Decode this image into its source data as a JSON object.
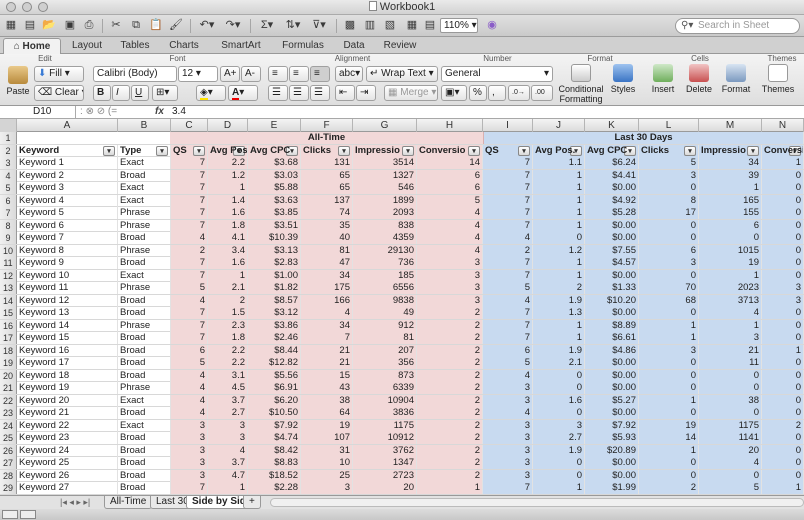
{
  "window": {
    "title": "Workbook1"
  },
  "toolbar": {
    "zoom": "110%",
    "search_placeholder": "Search in Sheet"
  },
  "ribbon": {
    "tabs": [
      "Home",
      "Layout",
      "Tables",
      "Charts",
      "SmartArt",
      "Formulas",
      "Data",
      "Review"
    ],
    "groups": {
      "edit": "Edit",
      "font": "Font",
      "alignment": "Alignment",
      "number": "Number",
      "format": "Format",
      "cells": "Cells",
      "themes": "Themes"
    },
    "paste": "Paste",
    "fill": "Fill",
    "clear": "Clear",
    "font_name": "Calibri (Body)",
    "font_size": "12",
    "wrap_text": "Wrap Text",
    "merge": "Merge",
    "number_format": "General",
    "conditional": "Conditional",
    "formatting": "Formatting",
    "styles": "Styles",
    "insert": "Insert",
    "delete": "Delete",
    "format": "Format",
    "themes": "Themes",
    "abc": "abc"
  },
  "formula_bar": {
    "cell": "D10",
    "value": "3.4",
    "fx": "fx"
  },
  "columns": [
    "A",
    "B",
    "C",
    "D",
    "E",
    "F",
    "G",
    "H",
    "I",
    "J",
    "K",
    "L",
    "M",
    "N"
  ],
  "row1": {
    "alltime": "All-Time",
    "last30": "Last 30 Days"
  },
  "headers": [
    "Keyword",
    "Type",
    "QS",
    "Avg Pos.",
    "Avg CPC",
    "Clicks",
    "Impressio",
    "Conversio",
    "QS",
    "Avg Pos.",
    "Avg CPC",
    "Clicks",
    "Impressio",
    "Conversio"
  ],
  "rows": [
    [
      "3",
      "Keyword 1",
      "Exact",
      "7",
      "2.2",
      "$3.68",
      "131",
      "3514",
      "14",
      "7",
      "1.1",
      "$6.24",
      "5",
      "34",
      "1"
    ],
    [
      "4",
      "Keyword 2",
      "Broad",
      "7",
      "1.2",
      "$3.03",
      "65",
      "1327",
      "6",
      "7",
      "1",
      "$4.41",
      "3",
      "39",
      "0"
    ],
    [
      "5",
      "Keyword 3",
      "Exact",
      "7",
      "1",
      "$5.88",
      "65",
      "546",
      "6",
      "7",
      "1",
      "$0.00",
      "0",
      "1",
      "0"
    ],
    [
      "6",
      "Keyword 4",
      "Exact",
      "7",
      "1.4",
      "$3.63",
      "137",
      "1899",
      "5",
      "7",
      "1",
      "$4.92",
      "8",
      "165",
      "0"
    ],
    [
      "7",
      "Keyword 5",
      "Phrase",
      "7",
      "1.6",
      "$3.85",
      "74",
      "2093",
      "4",
      "7",
      "1",
      "$5.28",
      "17",
      "155",
      "0"
    ],
    [
      "8",
      "Keyword 6",
      "Phrase",
      "7",
      "1.8",
      "$3.51",
      "35",
      "838",
      "4",
      "7",
      "1",
      "$0.00",
      "0",
      "6",
      "0"
    ],
    [
      "9",
      "Keyword 7",
      "Broad",
      "4",
      "4.1",
      "$10.39",
      "40",
      "4359",
      "4",
      "4",
      "0",
      "$0.00",
      "0",
      "0",
      "0"
    ],
    [
      "10",
      "Keyword 8",
      "Phrase",
      "2",
      "3.4",
      "$3.13",
      "81",
      "29130",
      "4",
      "2",
      "1.2",
      "$7.55",
      "6",
      "1015",
      "0"
    ],
    [
      "11",
      "Keyword 9",
      "Broad",
      "7",
      "1.6",
      "$2.83",
      "47",
      "736",
      "3",
      "7",
      "1",
      "$4.57",
      "3",
      "19",
      "0"
    ],
    [
      "12",
      "Keyword 10",
      "Exact",
      "7",
      "1",
      "$1.00",
      "34",
      "185",
      "3",
      "7",
      "1",
      "$0.00",
      "0",
      "1",
      "0"
    ],
    [
      "13",
      "Keyword 11",
      "Phrase",
      "5",
      "2.1",
      "$1.82",
      "175",
      "6556",
      "3",
      "5",
      "2",
      "$1.33",
      "70",
      "2023",
      "3"
    ],
    [
      "14",
      "Keyword 12",
      "Broad",
      "4",
      "2",
      "$8.57",
      "166",
      "9838",
      "3",
      "4",
      "1.9",
      "$10.20",
      "68",
      "3713",
      "3"
    ],
    [
      "15",
      "Keyword 13",
      "Broad",
      "7",
      "1.5",
      "$3.12",
      "4",
      "49",
      "2",
      "7",
      "1.3",
      "$0.00",
      "0",
      "4",
      "0"
    ],
    [
      "16",
      "Keyword 14",
      "Phrase",
      "7",
      "2.3",
      "$3.86",
      "34",
      "912",
      "2",
      "7",
      "1",
      "$8.89",
      "1",
      "1",
      "0"
    ],
    [
      "17",
      "Keyword 15",
      "Broad",
      "7",
      "1.8",
      "$2.46",
      "7",
      "81",
      "2",
      "7",
      "1",
      "$6.61",
      "1",
      "3",
      "0"
    ],
    [
      "18",
      "Keyword 16",
      "Broad",
      "6",
      "2.2",
      "$8.44",
      "21",
      "207",
      "2",
      "6",
      "1.9",
      "$4.86",
      "3",
      "21",
      "1"
    ],
    [
      "19",
      "Keyword 17",
      "Broad",
      "5",
      "2.2",
      "$12.82",
      "21",
      "356",
      "2",
      "5",
      "2.1",
      "$0.00",
      "0",
      "11",
      "0"
    ],
    [
      "20",
      "Keyword 18",
      "Broad",
      "4",
      "3.1",
      "$5.56",
      "15",
      "873",
      "2",
      "4",
      "0",
      "$0.00",
      "0",
      "0",
      "0"
    ],
    [
      "21",
      "Keyword 19",
      "Phrase",
      "4",
      "4.5",
      "$6.91",
      "43",
      "6339",
      "2",
      "3",
      "0",
      "$0.00",
      "0",
      "0",
      "0"
    ],
    [
      "22",
      "Keyword 20",
      "Exact",
      "4",
      "3.7",
      "$6.20",
      "38",
      "10904",
      "2",
      "3",
      "1.6",
      "$5.27",
      "1",
      "38",
      "0"
    ],
    [
      "23",
      "Keyword 21",
      "Broad",
      "4",
      "2.7",
      "$10.50",
      "64",
      "3836",
      "2",
      "4",
      "0",
      "$0.00",
      "0",
      "0",
      "0"
    ],
    [
      "24",
      "Keyword 22",
      "Exact",
      "3",
      "3",
      "$7.92",
      "19",
      "1175",
      "2",
      "3",
      "3",
      "$7.92",
      "19",
      "1175",
      "2"
    ],
    [
      "25",
      "Keyword 23",
      "Broad",
      "3",
      "3",
      "$4.74",
      "107",
      "10912",
      "2",
      "3",
      "2.7",
      "$5.93",
      "14",
      "1141",
      "0"
    ],
    [
      "26",
      "Keyword 24",
      "Broad",
      "3",
      "4",
      "$8.42",
      "31",
      "3762",
      "2",
      "3",
      "1.9",
      "$20.89",
      "1",
      "20",
      "0"
    ],
    [
      "27",
      "Keyword 25",
      "Broad",
      "3",
      "3.7",
      "$8.83",
      "10",
      "1347",
      "2",
      "3",
      "0",
      "$0.00",
      "0",
      "4",
      "0"
    ],
    [
      "28",
      "Keyword 26",
      "Broad",
      "3",
      "4.7",
      "$18.52",
      "25",
      "2723",
      "2",
      "3",
      "0",
      "$0.00",
      "0",
      "0",
      "0"
    ],
    [
      "29",
      "Keyword 27",
      "Broad",
      "7",
      "1",
      "$2.28",
      "3",
      "20",
      "1",
      "7",
      "1",
      "$1.99",
      "2",
      "5",
      "1"
    ]
  ],
  "sheet_tabs": [
    "All-Time",
    "Last 30",
    "Side by Side",
    "+"
  ]
}
